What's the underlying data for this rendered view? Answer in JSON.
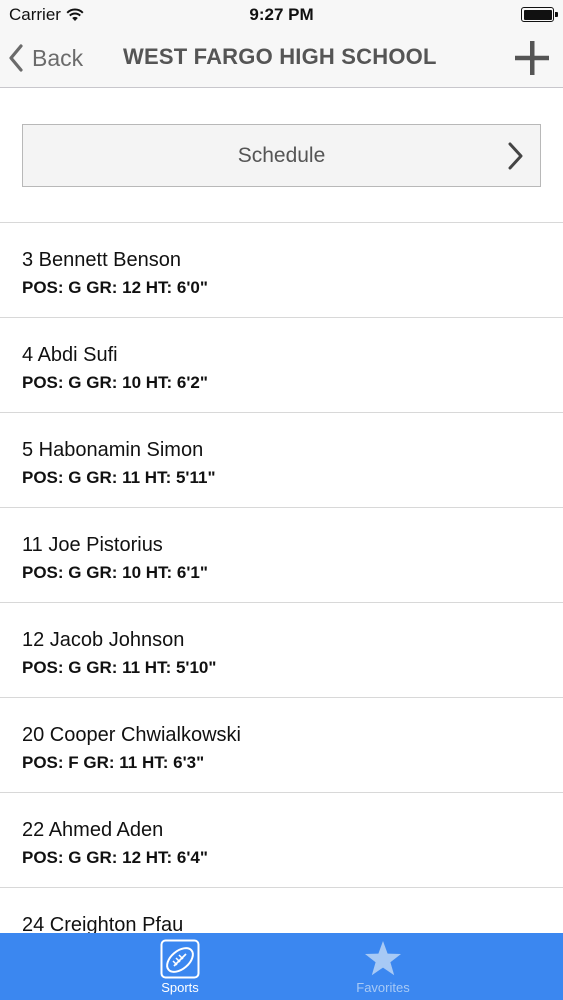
{
  "status_bar": {
    "carrier": "Carrier",
    "time": "9:27 PM",
    "battery_level": 1.0
  },
  "nav": {
    "back_label": "Back",
    "title": "WEST FARGO HIGH SCHOOL",
    "add_icon": "plus-icon"
  },
  "schedule": {
    "label": "Schedule",
    "icon": "chevron-right-icon"
  },
  "roster": [
    {
      "name": "3 Bennett Benson",
      "info": "POS: G GR: 12 HT: 6'0\""
    },
    {
      "name": "4 Abdi Sufi",
      "info": "POS: G GR: 10 HT: 6'2\""
    },
    {
      "name": "5 Habonamin Simon",
      "info": "POS: G GR: 11 HT: 5'11\""
    },
    {
      "name": "11 Joe Pistorius",
      "info": "POS: G GR: 10 HT: 6'1\""
    },
    {
      "name": "12 Jacob Johnson",
      "info": "POS: G GR: 11 HT: 5'10\""
    },
    {
      "name": "20 Cooper Chwialkowski",
      "info": "POS: F GR: 11 HT: 6'3\""
    },
    {
      "name": "22 Ahmed Aden",
      "info": "POS: G GR: 12 HT: 6'4\""
    },
    {
      "name": "24 Creighton Pfau",
      "info": ""
    }
  ],
  "tabs": [
    {
      "label": "Sports",
      "icon": "football-icon",
      "selected": true
    },
    {
      "label": "Favorites",
      "icon": "star-icon",
      "selected": false
    }
  ],
  "colors": {
    "tab_bar": "#3b87f0",
    "nav_bar": "#f7f7f7",
    "nav_text": "#555555"
  }
}
